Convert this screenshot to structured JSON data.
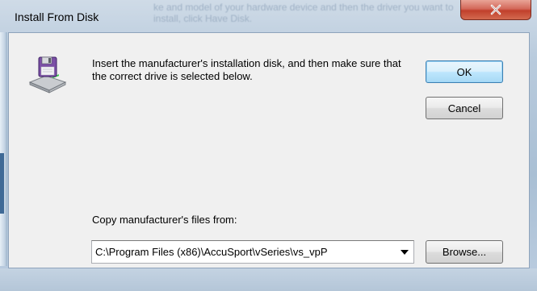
{
  "window": {
    "title": "Install From Disk",
    "background_ghost_text": "ke and model of your hardware device and then\nthe driver you want to install, click Have Disk."
  },
  "dialog": {
    "message": "Insert the manufacturer's installation disk, and then make sure that the correct drive is selected below.",
    "ok_label": "OK",
    "cancel_label": "Cancel",
    "copy_label": "Copy manufacturer's files from:",
    "path_value": "C:\\Program Files (x86)\\AccuSport\\vSeries\\vs_vpP",
    "browse_label": "Browse..."
  },
  "icons": {
    "disk": "floppy-disk-drive-icon",
    "close": "close-icon",
    "dropdown": "chevron-down-icon"
  },
  "colors": {
    "close_button": "#c1402c",
    "default_button_border": "#3c7fb1",
    "disk_purple": "#7b4fa6"
  }
}
